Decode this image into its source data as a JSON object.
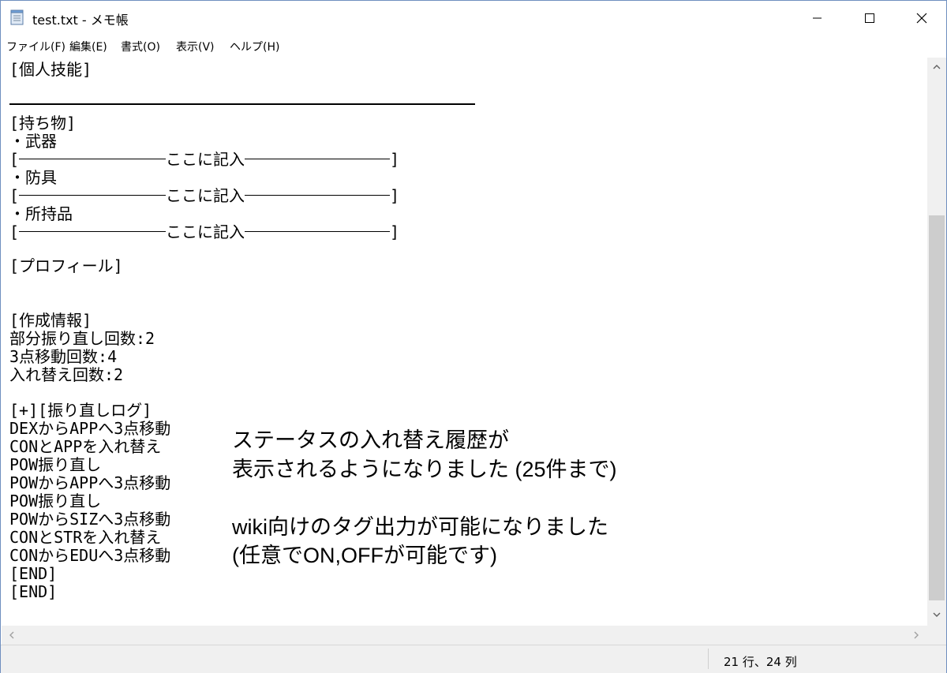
{
  "window": {
    "title": "test.txt - メモ帳",
    "icon": "notepad-icon"
  },
  "menu": {
    "items": [
      "ファイル(F)",
      "編集(E)",
      "書式(O)",
      "表示(V)",
      "ヘルプ(H)"
    ]
  },
  "editor": {
    "lines": {
      "l0": "[個人技能]",
      "l2": "[持ち物]",
      "l3": "・武器",
      "l4_open": "[",
      "l4_mid": "ここに記入",
      "l4_close": "]",
      "l5": "・防具",
      "l6_open": "[",
      "l6_mid": "ここに記入",
      "l6_close": "]",
      "l7": "・所持品",
      "l8_open": "[",
      "l8_mid": "ここに記入",
      "l8_close": "]",
      "l10": "[プロフィール]",
      "l13": "[作成情報]",
      "l14": "部分振り直し回数:2",
      "l15": "3点移動回数:4",
      "l16": "入れ替え回数:2",
      "l18": "[+][振り直しログ]",
      "l19": "DEXからAPPへ3点移動",
      "l20": "CONとAPPを入れ替え",
      "l21": "POW振り直し",
      "l22": "POWからAPPへ3点移動",
      "l23": "POW振り直し",
      "l24": "POWからSIZへ3点移動",
      "l25": "CONとSTRを入れ替え",
      "l26": "CONからEDUへ3点移動",
      "l27": "[END]",
      "l28": "[END]"
    }
  },
  "annotation": {
    "line1": "ステータスの入れ替え履歴が",
    "line2": "表示されるようになりました (25件まで)",
    "line3": "wiki向けのタグ出力が可能になりました",
    "line4": "(任意でON,OFFが可能です)"
  },
  "status": {
    "cursor": "21 行、24 列"
  }
}
